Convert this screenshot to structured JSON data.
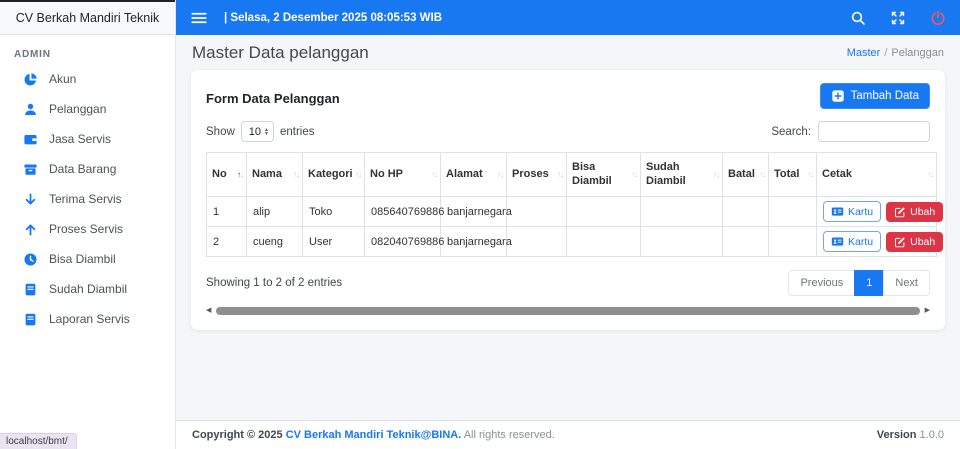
{
  "window": {
    "brand": "CV Berkah Mandiri Teknik",
    "status_tooltip": "localhost/bmt/"
  },
  "topbar": {
    "separator": "|",
    "datetime": "Selasa, 2 Desember 2025 08:05:53 WIB"
  },
  "sidebar": {
    "section_label": "ADMIN",
    "items": [
      {
        "label": "Akun",
        "icon": "pie-chart-icon"
      },
      {
        "label": "Pelanggan",
        "icon": "user-icon"
      },
      {
        "label": "Jasa Servis",
        "icon": "wallet-icon"
      },
      {
        "label": "Data Barang",
        "icon": "archive-icon"
      },
      {
        "label": "Terima Servis",
        "icon": "arrow-down-icon"
      },
      {
        "label": "Proses Servis",
        "icon": "arrow-up-icon"
      },
      {
        "label": "Bisa Diambil",
        "icon": "clock-icon"
      },
      {
        "label": "Sudah Diambil",
        "icon": "book-icon"
      },
      {
        "label": "Laporan Servis",
        "icon": "book-icon"
      }
    ]
  },
  "page": {
    "title": "Master Data pelanggan",
    "breadcrumb": {
      "link": "Master",
      "separator": "/",
      "current": "Pelanggan"
    }
  },
  "card": {
    "title": "Form Data Pelanggan",
    "add_button_label": "Tambah Data",
    "length": {
      "show_label": "Show",
      "value": "10",
      "entries_label": "entries"
    },
    "search": {
      "label": "Search:",
      "value": ""
    }
  },
  "table": {
    "columns": [
      "No",
      "Nama",
      "Kategori",
      "No HP",
      "Alamat",
      "Proses",
      "Bisa Diambil",
      "Sudah Diambil",
      "Batal",
      "Total",
      "Cetak"
    ],
    "rows": [
      {
        "no": "1",
        "nama": "alip",
        "kategori": "Toko",
        "no_hp": "085640769886",
        "alamat": "banjarnegara",
        "proses": "",
        "bisa_diambil": "",
        "sudah_diambil": "",
        "batal": "",
        "total": ""
      },
      {
        "no": "2",
        "nama": "cueng",
        "kategori": "User",
        "no_hp": "082040769886",
        "alamat": "banjarnegara",
        "proses": "",
        "bisa_diambil": "",
        "sudah_diambil": "",
        "batal": "",
        "total": ""
      }
    ],
    "actions": {
      "kartu_label": "Kartu",
      "ubah_label": "Ubah"
    },
    "info": "Showing 1 to 2 of 2 entries",
    "pagination": {
      "previous": "Previous",
      "page": "1",
      "next": "Next"
    }
  },
  "footer": {
    "copyright_prefix": "Copyright © 2025",
    "company_link": "CV Berkah Mandiri Teknik@BINA.",
    "rights": "All rights reserved.",
    "version_label": "Version",
    "version_value": "1.0.0"
  },
  "icons": {
    "sort_asc_glyph": "↑",
    "sort_desc_glyph": "↓",
    "select_up_glyph": "▲",
    "select_down_glyph": "▼",
    "scroll_left_glyph": "◀",
    "scroll_right_glyph": "▶"
  },
  "colors": {
    "primary": "#1778f2",
    "danger": "#dc3545",
    "content_background": "#f4f6f9"
  }
}
